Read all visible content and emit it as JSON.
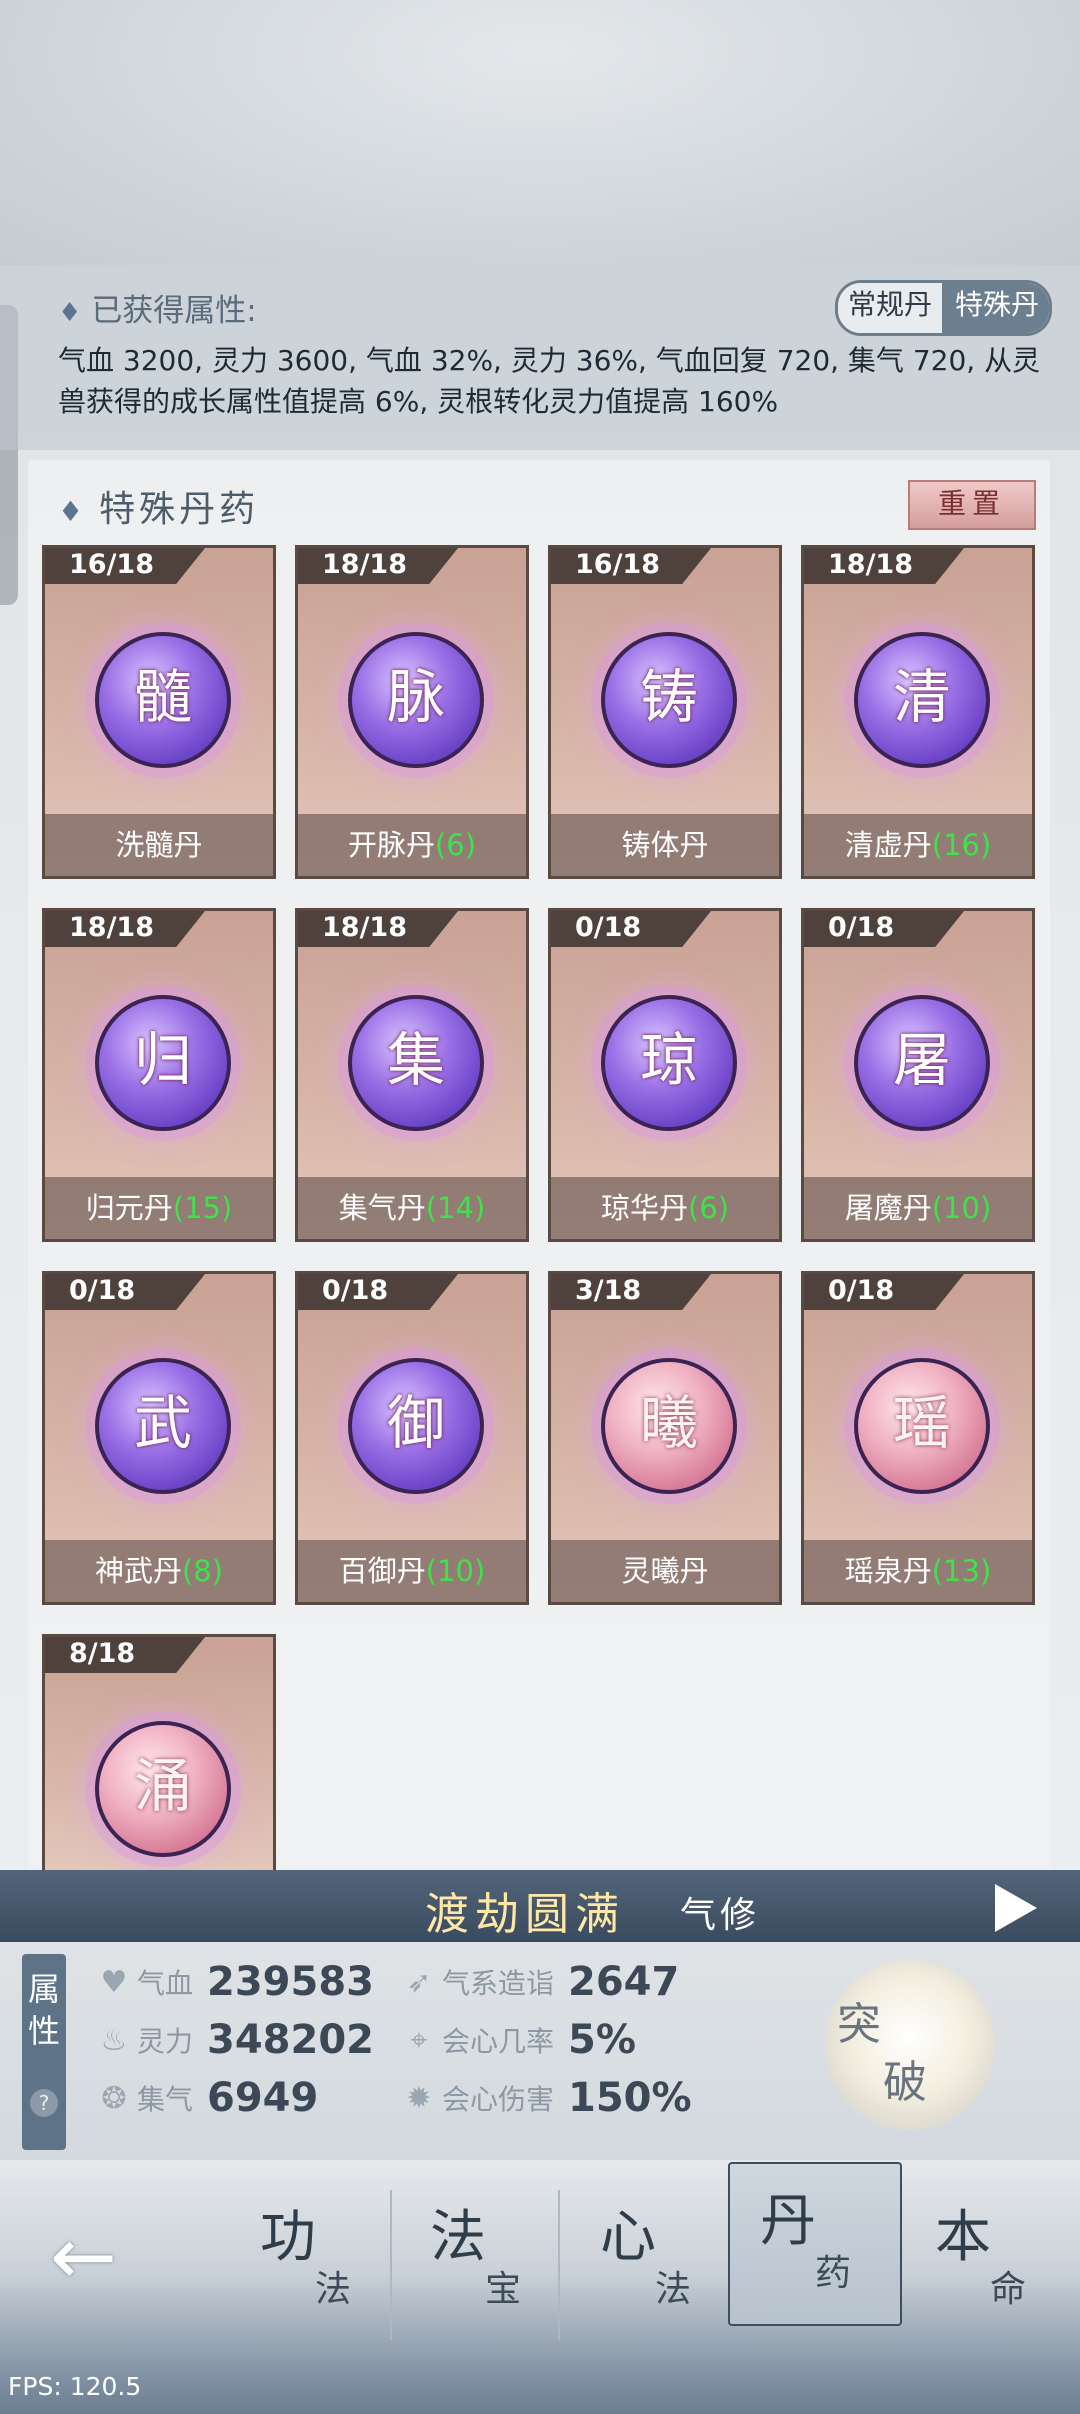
{
  "attributes": {
    "title": "已获得属性:",
    "text": "气血 3200, 灵力 3600, 气血 32%, 灵力 36%, 气血回复 720, 集气 720, 从灵兽获得的成长属性值提高 6%, 灵根转化灵力值提高 160%",
    "toggle": [
      "常规丹",
      "特殊丹"
    ]
  },
  "panel": {
    "title": "特殊丹药",
    "reset_label": "重置"
  },
  "pills": [
    {
      "count": "16/18",
      "glyph": "髓",
      "name": "洗髓丹",
      "bonus": "",
      "tone": "purple"
    },
    {
      "count": "18/18",
      "glyph": "脉",
      "name": "开脉丹",
      "bonus": "(6)",
      "tone": "purple"
    },
    {
      "count": "16/18",
      "glyph": "铸",
      "name": "铸体丹",
      "bonus": "",
      "tone": "purple"
    },
    {
      "count": "18/18",
      "glyph": "清",
      "name": "清虚丹",
      "bonus": "(16)",
      "tone": "purple"
    },
    {
      "count": "18/18",
      "glyph": "归",
      "name": "归元丹",
      "bonus": "(15)",
      "tone": "purple"
    },
    {
      "count": "18/18",
      "glyph": "集",
      "name": "集气丹",
      "bonus": "(14)",
      "tone": "purple"
    },
    {
      "count": "0/18",
      "glyph": "琼",
      "name": "琼华丹",
      "bonus": "(6)",
      "tone": "purple"
    },
    {
      "count": "0/18",
      "glyph": "屠",
      "name": "屠魔丹",
      "bonus": "(10)",
      "tone": "purple"
    },
    {
      "count": "0/18",
      "glyph": "武",
      "name": "神武丹",
      "bonus": "(8)",
      "tone": "purple"
    },
    {
      "count": "0/18",
      "glyph": "御",
      "name": "百御丹",
      "bonus": "(10)",
      "tone": "purple"
    },
    {
      "count": "3/18",
      "glyph": "曦",
      "name": "灵曦丹",
      "bonus": "",
      "tone": "pink"
    },
    {
      "count": "0/18",
      "glyph": "瑶",
      "name": "瑶泉丹",
      "bonus": "(13)",
      "tone": "pink"
    },
    {
      "count": "8/18",
      "glyph": "涌",
      "name": "",
      "bonus": "",
      "tone": "pink"
    }
  ],
  "realm": {
    "title": "渡劫圆满",
    "subtitle": "气修"
  },
  "stats": {
    "tag_line1": "属",
    "tag_line2": "性",
    "tag_help": "?",
    "hp_label": "气血",
    "hp_value": "239583",
    "mp_label": "灵力",
    "mp_value": "348202",
    "charge_label": "集气",
    "charge_value": "6949",
    "mastery_label": "气系造诣",
    "mastery_value": "2647",
    "crit_label": "会心几率",
    "crit_value": "5%",
    "critdmg_label": "会心伤害",
    "critdmg_value": "150%",
    "break_1": "突",
    "break_2": "破"
  },
  "nav": {
    "tabs": [
      {
        "big": "功",
        "small": "法"
      },
      {
        "big": "法",
        "small": "宝"
      },
      {
        "big": "心",
        "small": "法"
      },
      {
        "big": "丹",
        "small": "药"
      },
      {
        "big": "本",
        "small": "命"
      }
    ]
  },
  "fps": "FPS: 120.5"
}
